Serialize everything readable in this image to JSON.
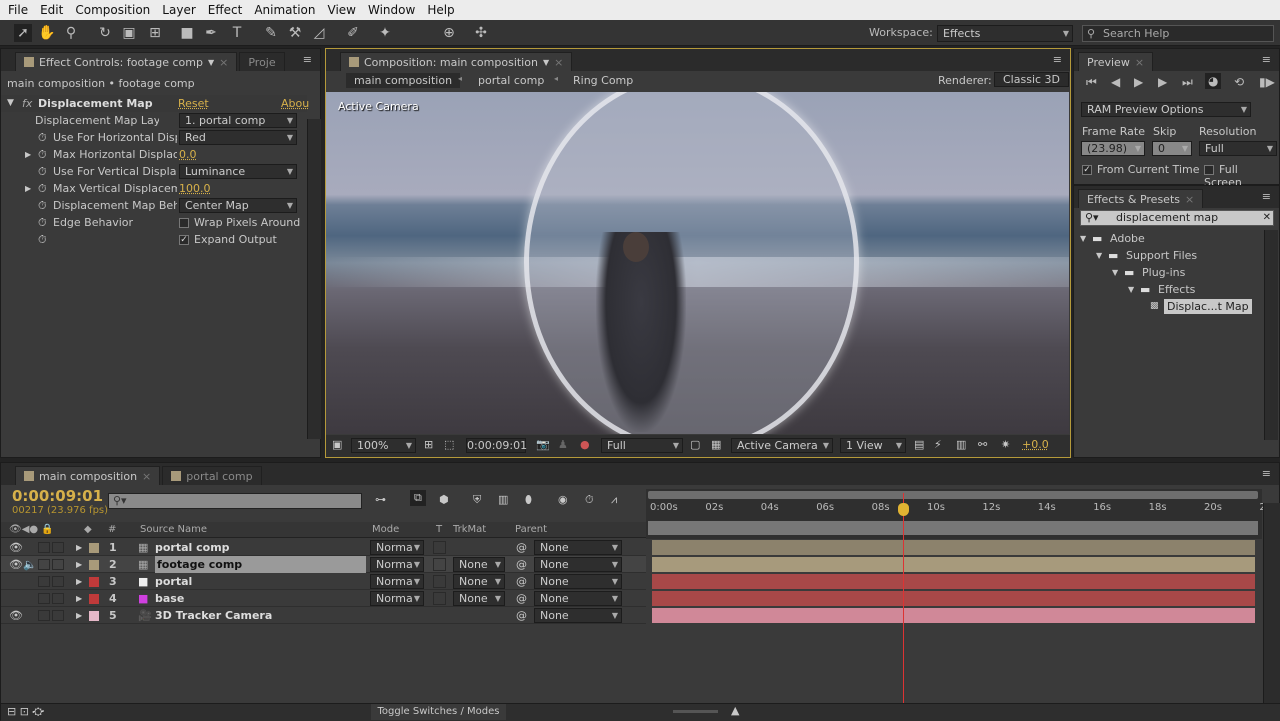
{
  "menu": [
    "File",
    "Edit",
    "Composition",
    "Layer",
    "Effect",
    "Animation",
    "View",
    "Window",
    "Help"
  ],
  "toolbar": {
    "workspace_label": "Workspace:",
    "workspace_value": "Effects",
    "search_placeholder": "Search Help"
  },
  "effect_controls": {
    "tab": "Effect Controls: footage comp",
    "tab2": "Proje",
    "breadcrumb": "main composition • footage comp",
    "effect_name": "Displacement Map",
    "reset": "Reset",
    "about": "Abou",
    "props": [
      {
        "label": "Displacement Map Layer",
        "value": "1. portal comp",
        "kind": "dropdown"
      },
      {
        "label": "Use For Horizontal Disp",
        "value": "Red",
        "kind": "dropdown"
      },
      {
        "label": "Max Horizontal Displace",
        "value": "0.0",
        "kind": "number"
      },
      {
        "label": "Use For Vertical Displac",
        "value": "Luminance",
        "kind": "dropdown"
      },
      {
        "label": "Max Vertical Displaceme",
        "value": "100.0",
        "kind": "number"
      },
      {
        "label": "Displacement Map Beha",
        "value": "Center Map",
        "kind": "dropdown"
      },
      {
        "label": "Edge Behavior",
        "value": "Wrap Pixels Around",
        "kind": "checkbox",
        "checked": false
      },
      {
        "label": "",
        "value": "Expand Output",
        "kind": "checkbox",
        "checked": true
      }
    ]
  },
  "composition": {
    "tab": "Composition: main composition",
    "breadcrumbs": [
      "main composition",
      "portal comp",
      "Ring Comp"
    ],
    "renderer_label": "Renderer:",
    "renderer": "Classic 3D",
    "viewer_label": "Active Camera",
    "footer": {
      "zoom": "100%",
      "timecode": "0:00:09:01",
      "resolution": "Full",
      "view": "Active Camera",
      "layout": "1 View",
      "exposure": "+0.0"
    }
  },
  "preview": {
    "tab": "Preview",
    "ram_options": "RAM Preview Options",
    "frame_rate_label": "Frame Rate",
    "skip_label": "Skip",
    "resolution_label": "Resolution",
    "frame_rate": "(23.98)",
    "skip": "0",
    "resolution": "Full",
    "from_current": "From Current Time",
    "full_screen": "Full Screen"
  },
  "effects_presets": {
    "tab": "Effects & Presets",
    "search": "displacement map",
    "tree": [
      "Adobe",
      "Support Files",
      "Plug-ins",
      "Effects",
      "Displac...t Map"
    ]
  },
  "timeline": {
    "tabs": [
      "main composition",
      "portal comp"
    ],
    "timecode": "0:00:09:01",
    "frame_info": "00217 (23.976 fps)",
    "headers": {
      "num": "#",
      "source": "Source Name",
      "mode": "Mode",
      "t": "T",
      "trkmat": "TrkMat",
      "parent": "Parent"
    },
    "layers": [
      {
        "num": "1",
        "name": "portal comp",
        "color": "#a89a7a",
        "mode": "Norma",
        "trkmat": "",
        "parent": "None",
        "bar": "#8c826c"
      },
      {
        "num": "2",
        "name": "footage comp",
        "color": "#a89a7a",
        "mode": "Norma",
        "trkmat": "None",
        "parent": "None",
        "bar": "#a79a7c"
      },
      {
        "num": "3",
        "name": "portal",
        "color": "#c03a3a",
        "mode": "Norma",
        "trkmat": "None",
        "parent": "None",
        "bar": "#a84848"
      },
      {
        "num": "4",
        "name": "base",
        "color": "#c03a3a",
        "mode": "Norma",
        "trkmat": "None",
        "parent": "None",
        "bar": "#a84848"
      },
      {
        "num": "5",
        "name": "3D Tracker Camera",
        "color": "#e6b8c8",
        "mode": "",
        "trkmat": "",
        "parent": "None",
        "bar": "#d08898"
      }
    ],
    "ruler": [
      "0:00s",
      "02s",
      "04s",
      "06s",
      "08s",
      "10s",
      "12s",
      "14s",
      "16s",
      "18s",
      "20s",
      "22"
    ],
    "playhead_seconds": 9.04,
    "toggle_label": "Toggle Switches / Modes"
  }
}
